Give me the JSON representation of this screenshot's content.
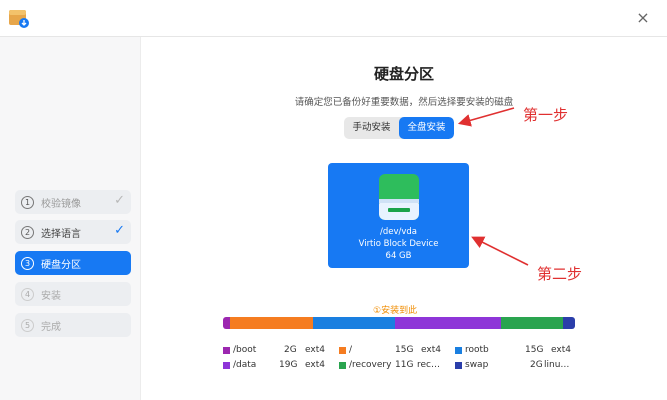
{
  "window": {
    "close_icon": "close-icon"
  },
  "sidebar": {
    "steps": [
      {
        "num": "1",
        "label": "校验镜像",
        "state": "done-gray"
      },
      {
        "num": "2",
        "label": "选择语言",
        "state": "done"
      },
      {
        "num": "3",
        "label": "硬盘分区",
        "state": "active"
      },
      {
        "num": "4",
        "label": "安装",
        "state": "pending"
      },
      {
        "num": "5",
        "label": "完成",
        "state": "pending"
      }
    ],
    "check_glyph": "✓"
  },
  "main": {
    "title": "硬盘分区",
    "subtitle": "请确定您已备份好重要数据，然后选择要安装的磁盘",
    "modes": [
      "手动安装",
      "全盘安装"
    ],
    "selected_mode": "全盘安装",
    "disk": {
      "path": "/dev/vda",
      "model": "Virtio Block Device",
      "size": "64 GB"
    },
    "install_marker": "①安装到此",
    "partitions": [
      {
        "color": "#9c27b0",
        "fraction": 0.02
      },
      {
        "color": "#f57c20",
        "fraction": 0.235
      },
      {
        "color": "#1a7fe0",
        "fraction": 0.235
      },
      {
        "color": "#8e35d8",
        "fraction": 0.3
      },
      {
        "color": "#2aa44f",
        "fraction": 0.175
      },
      {
        "color": "#2b3eaa",
        "fraction": 0.035
      }
    ],
    "legend": [
      {
        "name": "/boot",
        "size": "2G",
        "fs": "ext4",
        "color": "#9c27b0"
      },
      {
        "name": "/",
        "size": "15G",
        "fs": "ext4",
        "color": "#f57c20"
      },
      {
        "name": "rootb",
        "size": "15G",
        "fs": "ext4",
        "color": "#1a7fe0"
      },
      {
        "name": "/data",
        "size": "19G",
        "fs": "ext4",
        "color": "#8e35d8"
      },
      {
        "name": "/recovery",
        "size": "11G",
        "fs": "rec…",
        "color": "#2aa44f"
      },
      {
        "name": "swap",
        "size": "2G",
        "fs": "linu…",
        "color": "#2b3eaa"
      }
    ]
  },
  "annotations": {
    "step1": "第一步",
    "step2": "第二步"
  },
  "colors": {
    "accent": "#1779f3",
    "annotation": "#e03030"
  }
}
